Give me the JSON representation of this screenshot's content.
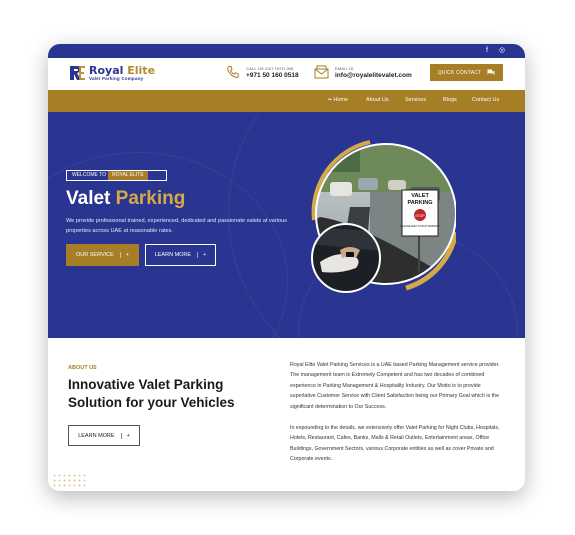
{
  "topbar": {
    "icons": [
      "facebook-icon",
      "instagram-icon"
    ],
    "facebook": "f",
    "instagram": "◎"
  },
  "logo": {
    "title_1": "Royal",
    "title_2": "Elite",
    "subtitle": "Valet Parking Company"
  },
  "header": {
    "phone_label": "CALL US 24/7 HOTLINE",
    "phone": "+971 50 160 0518",
    "email_label": "EMAIL ID",
    "email": "info@royalelitevalet.com",
    "quick_contact": "QUICK CONTACT"
  },
  "nav": {
    "items": [
      "Home",
      "About Us",
      "Services",
      "Blogs",
      "Contact Us"
    ],
    "home_prefix": "•• "
  },
  "hero": {
    "badge_1": "WELCOME TO",
    "badge_2": "ROYAL ELITE",
    "title_1": "Valet",
    "title_2": "Parking",
    "description": "We provide professional trained, experienced, dedicated and passionate valets at various properties across UAE at reasonable rates.",
    "btn_service": "OUR SERVICE",
    "btn_learn": "LEARN MORE",
    "sign_1": "VALET",
    "sign_2": "PARKING",
    "sign_3": "STOP",
    "sign_4": "PLEASE WAIT FOR ATTENDANT"
  },
  "about": {
    "label": "ABOUT US",
    "title": "Innovative Valet Parking Solution for your Vehicles",
    "btn": "LEARN MORE",
    "para_1": "Royal Elite Valet Parking Services is a UAE based Parking Management service provider. The management team is Extremely Competent and has two decades of combined experience in Parking Management & Hospitality Industry. Our Motto is to provide superlative Customer Service with Client Satisfaction being our Primary Goal which is the significant determination to Our Success.",
    "para_2": "In expounding to the details, we extensively offer Valet Parking for Night Clubs, Hospitals, Hotels, Restaurant, Cafes, Banks, Malls & Retail Outlets, Entertainment areas, Office Buildings, Government Sectors, various Corporate entities as well as cover Private and Corporate events."
  },
  "colors": {
    "navy": "#2a3591",
    "gold": "#a57e25"
  }
}
